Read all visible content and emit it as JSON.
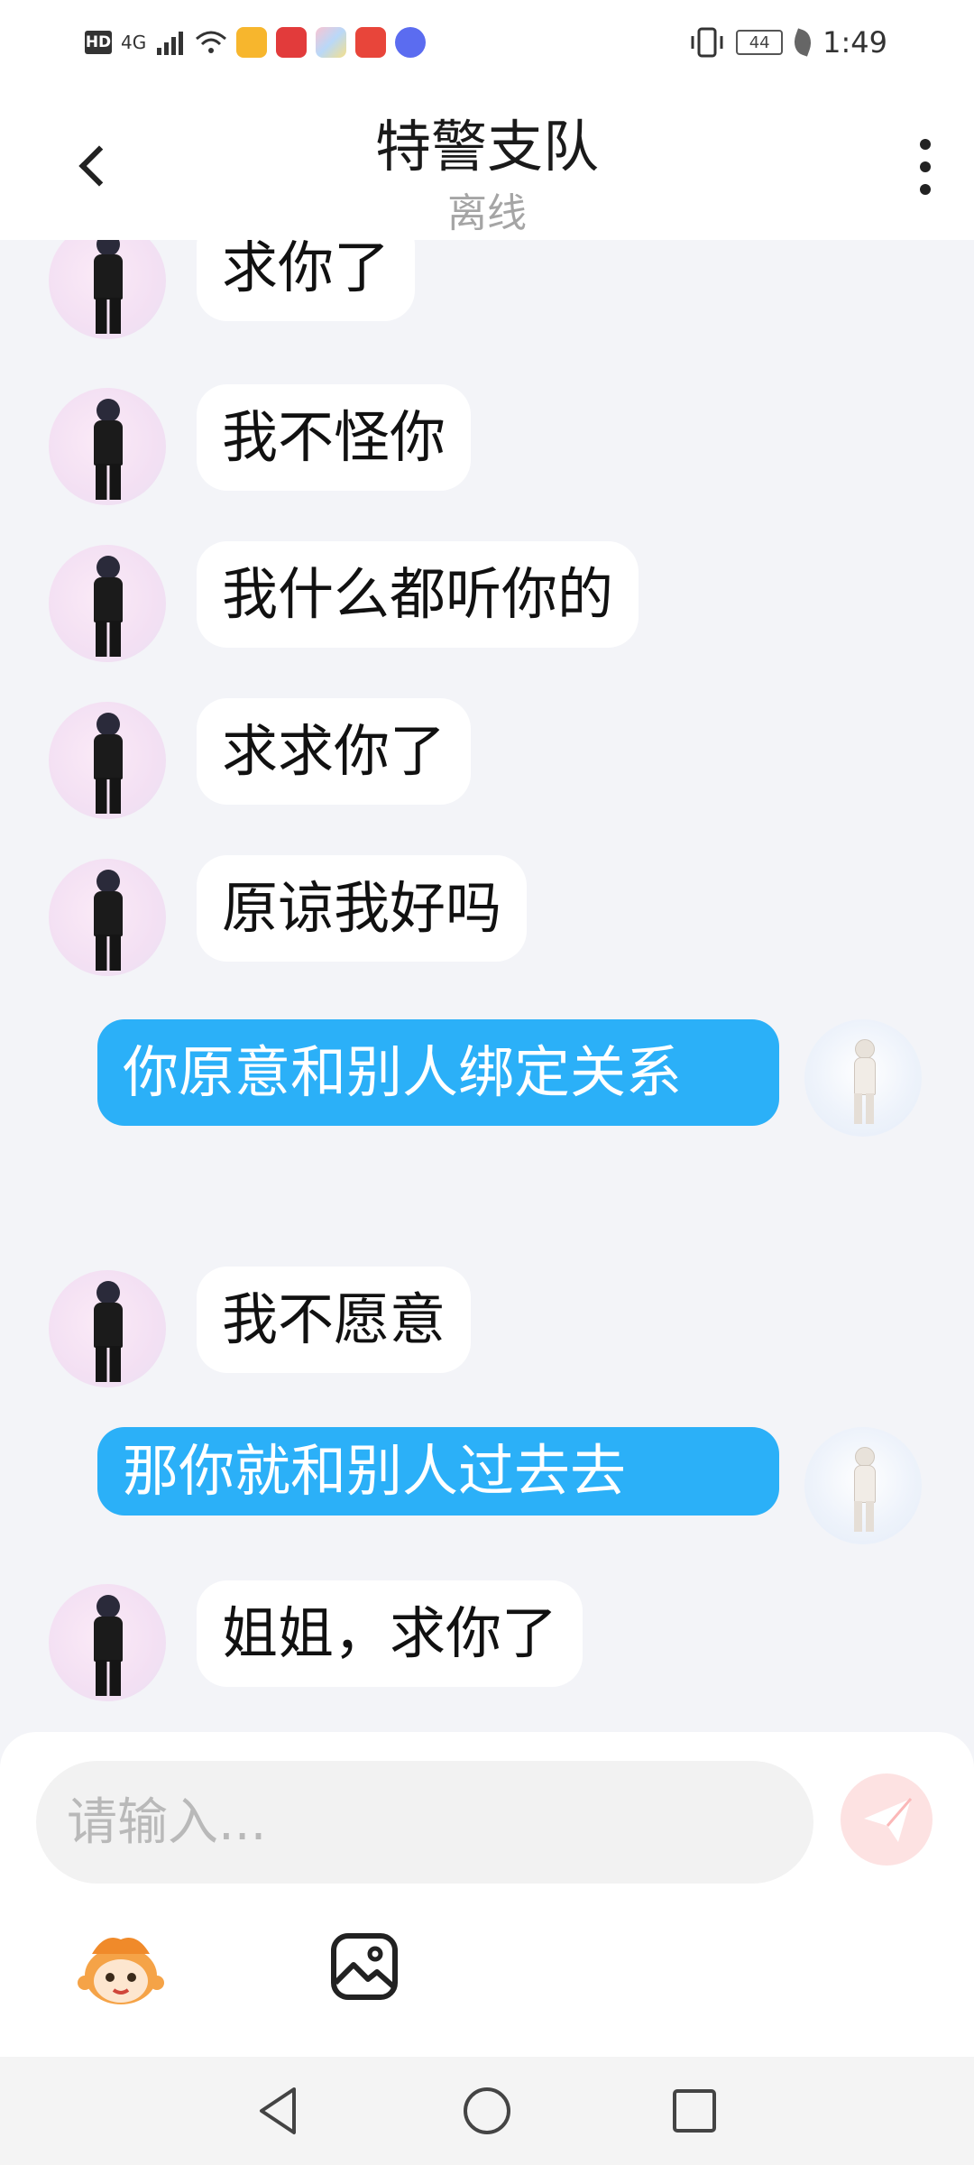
{
  "status_bar": {
    "hd": "HD",
    "signal": "4G",
    "battery": "44",
    "time": "1:49"
  },
  "header": {
    "title": "特警支队",
    "subtitle": "离线"
  },
  "messages": [
    {
      "from": "them",
      "text": "求你了"
    },
    {
      "from": "them",
      "text": "我不怪你"
    },
    {
      "from": "them",
      "text": "我什么都听你的"
    },
    {
      "from": "them",
      "text": "求求你了"
    },
    {
      "from": "them",
      "text": "原谅我好吗"
    },
    {
      "from": "me",
      "text": "你原意和别人绑定关系"
    },
    {
      "from": "them",
      "text": "我不愿意"
    },
    {
      "from": "me",
      "text": "那你就和别人过去去"
    },
    {
      "from": "them",
      "text": "姐姐，求你了"
    }
  ],
  "input": {
    "placeholder": "请输入..."
  },
  "colors": {
    "my_bubble": "#2bb0f8",
    "their_bubble": "#ffffff",
    "background": "#f3f4f8",
    "send_button": "#fde2e2"
  },
  "icons": [
    "back-chevron-icon",
    "more-vertical-icon",
    "send-icon",
    "emoji-icon",
    "image-icon",
    "nav-back-icon",
    "nav-home-icon",
    "nav-recents-icon"
  ]
}
